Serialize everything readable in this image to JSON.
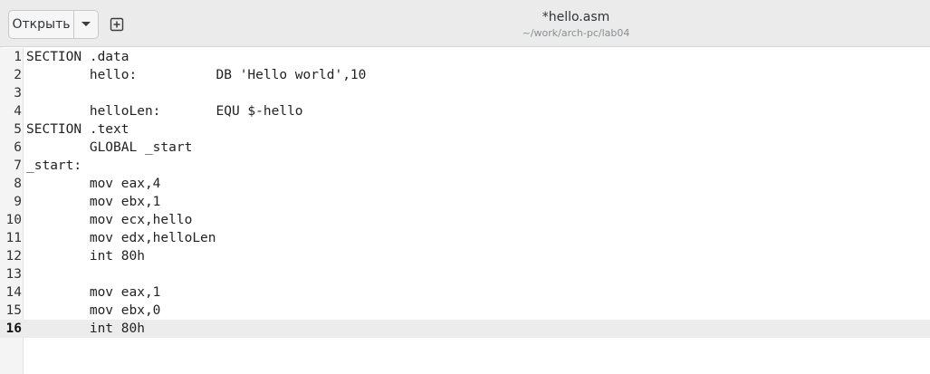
{
  "header": {
    "open_label": "Открыть",
    "title": "*hello.asm",
    "subtitle": "~/work/arch-pc/lab04",
    "open_arrow_icon": "chevron-down-icon",
    "new_tab_icon": "new-tab-icon"
  },
  "editor": {
    "current_line": 16,
    "lines": [
      {
        "num": "1",
        "text": "SECTION .data"
      },
      {
        "num": "2",
        "text": "        hello:          DB 'Hello world',10"
      },
      {
        "num": "3",
        "text": ""
      },
      {
        "num": "4",
        "text": "        helloLen:       EQU $-hello"
      },
      {
        "num": "5",
        "text": "SECTION .text"
      },
      {
        "num": "6",
        "text": "        GLOBAL _start"
      },
      {
        "num": "7",
        "text": "_start:"
      },
      {
        "num": "8",
        "text": "        mov eax,4"
      },
      {
        "num": "9",
        "text": "        mov ebx,1"
      },
      {
        "num": "10",
        "text": "        mov ecx,hello"
      },
      {
        "num": "11",
        "text": "        mov edx,helloLen"
      },
      {
        "num": "12",
        "text": "        int 80h"
      },
      {
        "num": "13",
        "text": ""
      },
      {
        "num": "14",
        "text": "        mov eax,1"
      },
      {
        "num": "15",
        "text": "        mov ebx,0"
      },
      {
        "num": "16",
        "text": "        int 80h"
      }
    ]
  }
}
